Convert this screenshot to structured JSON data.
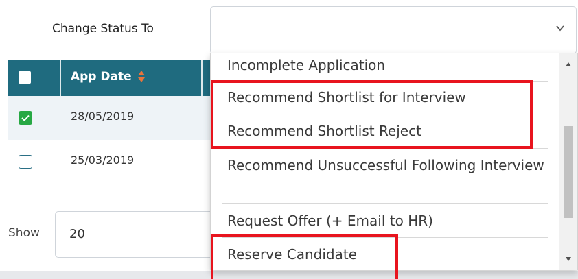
{
  "form": {
    "change_status_label": "Change Status To",
    "status_value": ""
  },
  "table": {
    "header": {
      "app_date": "App Date"
    },
    "rows": [
      {
        "date": "28/05/2019",
        "checked": true
      },
      {
        "date": "25/03/2019",
        "checked": false
      }
    ]
  },
  "pagination": {
    "show_label": "Show",
    "page_size": "20"
  },
  "dropdown": {
    "options": [
      "Incomplete Application",
      "Recommend Shortlist for Interview",
      "Recommend Shortlist Reject",
      "Recommend Unsuccessful Following Interview",
      "Request Offer (+ Email to HR)",
      "Reserve Candidate"
    ]
  },
  "colors": {
    "header_bg": "#1f6b7f",
    "checked_green": "#27a844",
    "highlight_red": "#e8141e",
    "sort_orange": "#e8743b"
  },
  "icons": {
    "select_chevron": "chevron-down-icon",
    "sort": "sort-icon",
    "checkmark": "check-icon",
    "scroll_up": "scroll-up-arrow-icon",
    "scroll_down": "scroll-down-arrow-icon"
  }
}
